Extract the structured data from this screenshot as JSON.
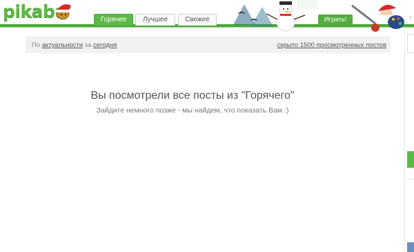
{
  "logo": {
    "text": "pikabu"
  },
  "tabs": [
    {
      "label": "Горячее",
      "active": true
    },
    {
      "label": "Лучшее",
      "active": false
    },
    {
      "label": "Свежее",
      "active": false
    }
  ],
  "play_button": "Играть!",
  "filter": {
    "prefix": "По",
    "sort_link": "актуальности",
    "middle": "за",
    "period_link": "сегодня",
    "hidden_link": "скрыто 1500 просмотренных постов"
  },
  "message": {
    "title": "Вы посмотрели все посты из \"Горячего\"",
    "subtitle": "Зайдите немного позже - мы найдем, что показать Вам :)"
  },
  "sidebar": {
    "search_hint": "г"
  },
  "colors": {
    "brand_green": "#5cb643",
    "tab_active": "#5fb84a",
    "header_line": "#4aa83a",
    "filter_bg": "#f1f1ef"
  },
  "icons": [
    "santa-hat-icon",
    "snowman-icon",
    "santa-icon",
    "palette-icon"
  ]
}
